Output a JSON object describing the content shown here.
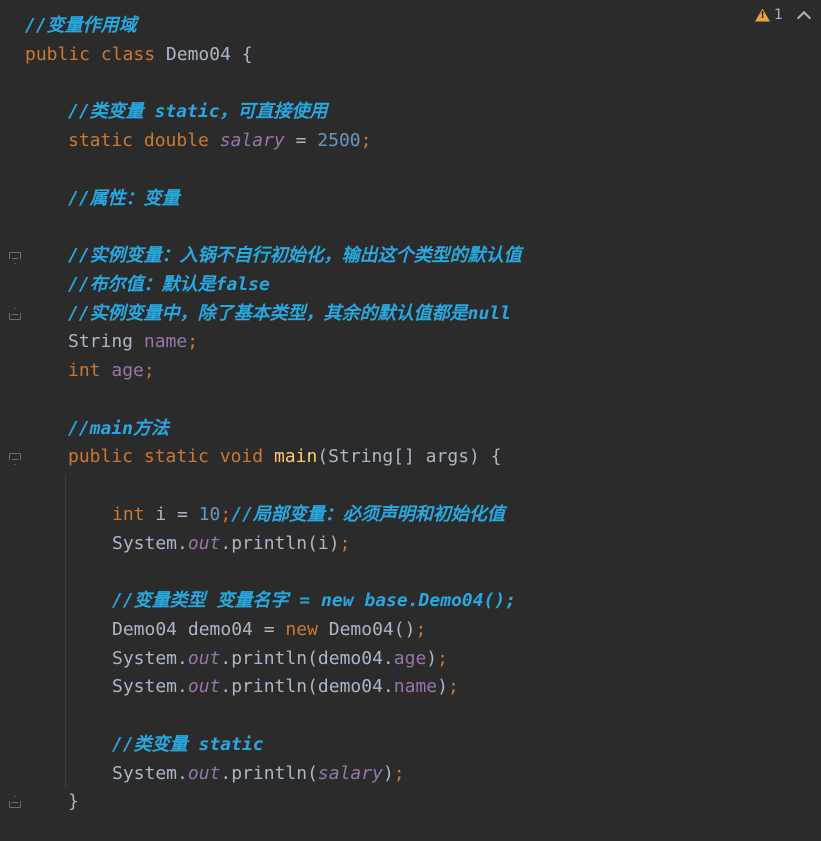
{
  "inspection": {
    "warning_count": "1"
  },
  "code": {
    "l1_comment": "//变量作用域",
    "l2_public": "public",
    "l2_class": "class",
    "l2_name": "Demo04",
    "l2_brace": "{",
    "l4_comment": "//类变量 static，可直接使用",
    "l5_static": "static",
    "l5_double": "double",
    "l5_field": "salary",
    "l5_eq": " = ",
    "l5_value": "2500",
    "l5_semi": ";",
    "l7_comment": "//属性：变量",
    "l9_comment": "//实例变量：入锅不自行初始化，输出这个类型的默认值",
    "l10_comment": "//布尔值：默认是false",
    "l11_comment": "//实例变量中，除了基本类型，其余的默认值都是null",
    "l12_type": "String",
    "l12_field": "name",
    "l12_semi": ";",
    "l13_type": "int",
    "l13_field": "age",
    "l13_semi": ";",
    "l15_comment": "//main方法",
    "l16_public": "public",
    "l16_static": "static",
    "l16_void": "void",
    "l16_method": "main",
    "l16_params": "(String[] args) {",
    "l18_type": "int",
    "l18_var": " i = ",
    "l18_value": "10",
    "l18_semi": ";",
    "l18_comment": "//局部变量：必须声明和初始化值",
    "l19_system": "System.",
    "l19_out": "out",
    "l19_call": ".println(i)",
    "l19_semi": ";",
    "l21_comment": "//变量类型 变量名字 = new base.Demo04();",
    "l22_decl": "Demo04 demo04 = ",
    "l22_new": "new",
    "l22_ctor": " Demo04()",
    "l22_semi": ";",
    "l23_system": "System.",
    "l23_out": "out",
    "l23_call": ".println(demo04.",
    "l23_field": "age",
    "l23_close": ")",
    "l23_semi": ";",
    "l24_system": "System.",
    "l24_out": "out",
    "l24_call": ".println(demo04.",
    "l24_field": "name",
    "l24_close": ")",
    "l24_semi": ";",
    "l26_comment": "//类变量 static",
    "l27_system": "System.",
    "l27_out": "out",
    "l27_call": ".println(",
    "l27_field": "salary",
    "l27_close": ")",
    "l27_semi": ";",
    "l28_brace": "}"
  }
}
